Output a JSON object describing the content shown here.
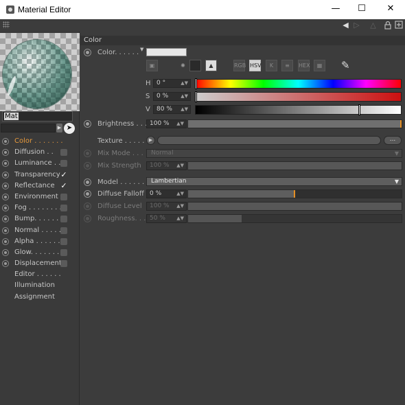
{
  "window": {
    "title": "Material Editor",
    "buttons": {
      "minimize": "—",
      "maximize": "☐",
      "close": "✕"
    }
  },
  "toolbar": {
    "icons": [
      "grip-icon",
      "back-arrow-icon",
      "forward-arrow-icon",
      "up-arrow-icon",
      "lock-icon",
      "new-window-icon"
    ]
  },
  "left_panel": {
    "material_name": "Mat",
    "channels": [
      {
        "label": "Color . . . . . . .",
        "active": true,
        "checked": null
      },
      {
        "label": "Diffusion . .",
        "active": false,
        "checked": false
      },
      {
        "label": "Luminance . .",
        "active": false,
        "checked": false
      },
      {
        "label": "Transparency",
        "active": false,
        "checked": true
      },
      {
        "label": "Reflectance",
        "active": false,
        "checked": true
      },
      {
        "label": "Environment",
        "active": false,
        "checked": false
      },
      {
        "label": "Fog . . . . . . . .",
        "active": false,
        "checked": false
      },
      {
        "label": "Bump. . . . . . .",
        "active": false,
        "checked": false
      },
      {
        "label": "Normal . . . . .",
        "active": false,
        "checked": false
      },
      {
        "label": "Alpha . . . . . .",
        "active": false,
        "checked": false
      },
      {
        "label": "Glow. . . . . . .",
        "active": false,
        "checked": false
      },
      {
        "label": "Displacement",
        "active": false,
        "checked": false
      },
      {
        "label": "Editor . . . . . .",
        "active": false,
        "checked": null
      },
      {
        "label": "Illumination",
        "active": false,
        "checked": null
      },
      {
        "label": "Assignment",
        "active": false,
        "checked": null
      }
    ]
  },
  "color_section": {
    "header": "Color",
    "color_label": "Color. . . . . .",
    "swatch_color": "#e7e7e7",
    "mode_icons": [
      "RGB",
      "HSV",
      "K",
      "≡",
      "HEX",
      "▦"
    ],
    "hsv": {
      "h_label": "H",
      "h_value": "0 °",
      "s_label": "S",
      "s_value": "0 %",
      "v_label": "V",
      "v_value": "80 %",
      "v_fraction": 0.8
    },
    "brightness_label": "Brightness . . .",
    "brightness_value": "100 %",
    "brightness_fraction": 1.0,
    "texture_label": "Texture . . . . . .",
    "texture_more": "...",
    "mix_mode_label": "Mix Mode . . . .",
    "mix_mode_value": "Normal",
    "mix_strength_label": "Mix Strength",
    "mix_strength_value": "100 %",
    "model_label": "Model . . . . . . .",
    "model_value": "Lambertian",
    "diffuse_falloff_label": "Diffuse Falloff",
    "diffuse_falloff_value": "0 %",
    "diffuse_falloff_fraction": 0.5,
    "diffuse_level_label": "Diffuse Level",
    "diffuse_level_value": "100 %",
    "roughness_label": "Roughness. . . .",
    "roughness_value": "50 %",
    "roughness_fraction": 0.25
  },
  "colors": {
    "accent_orange": "#e89a3c",
    "panel_bg": "#3c3c3c",
    "slider_mark": "#e58f24"
  }
}
